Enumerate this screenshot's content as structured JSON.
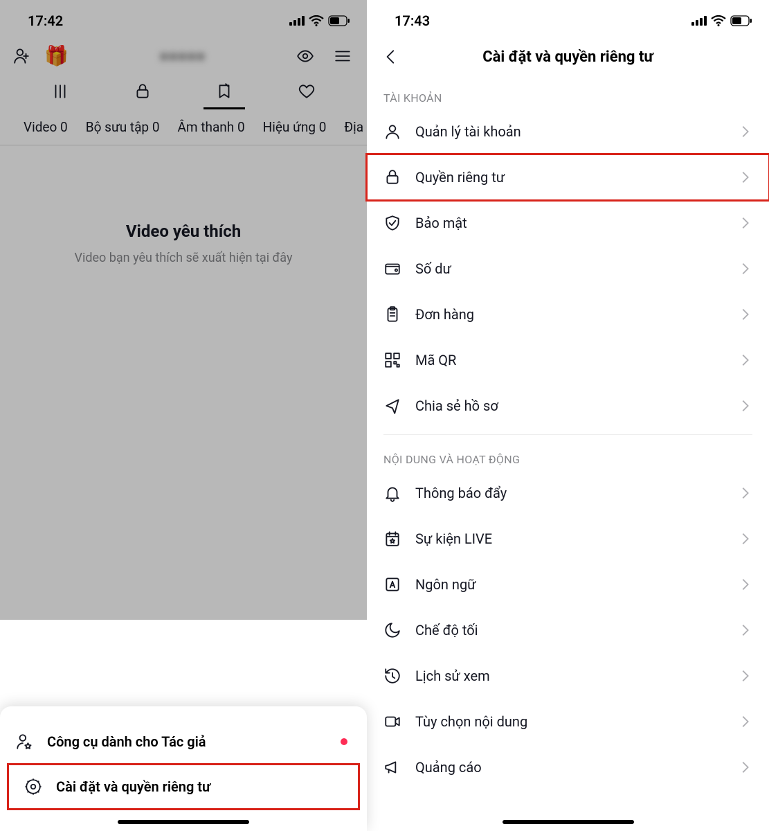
{
  "left": {
    "time": "17:42",
    "profile_name": "●●●●●",
    "subtabs": {
      "video": "Video 0",
      "bosuutap": "Bộ sưu tập 0",
      "amthanh": "Âm thanh 0",
      "hieuung": "Hiệu ứng 0",
      "dia": "Địa"
    },
    "empty_title": "Video yêu thích",
    "empty_body": "Video bạn yêu thích sẽ xuất hiện tại đây",
    "sheet": {
      "creator": "Công cụ dành cho Tác giả",
      "settings": "Cài đặt và quyền riêng tư"
    }
  },
  "right": {
    "time": "17:43",
    "title": "Cài đặt và quyền riêng tư",
    "section_account": "TÀI KHOẢN",
    "items_account": {
      "manage": "Quản lý tài khoản",
      "privacy": "Quyền riêng tư",
      "security": "Bảo mật",
      "balance": "Số dư",
      "orders": "Đơn hàng",
      "qr": "Mã QR",
      "share": "Chia sẻ hồ sơ"
    },
    "section_content": "NỘI DUNG VÀ HOẠT ĐỘNG",
    "items_content": {
      "push": "Thông báo đẩy",
      "live": "Sự kiện LIVE",
      "lang": "Ngôn ngữ",
      "dark": "Chế độ tối",
      "history": "Lịch sử xem",
      "contentpref": "Tùy chọn nội dung",
      "ads": "Quảng cáo"
    }
  }
}
